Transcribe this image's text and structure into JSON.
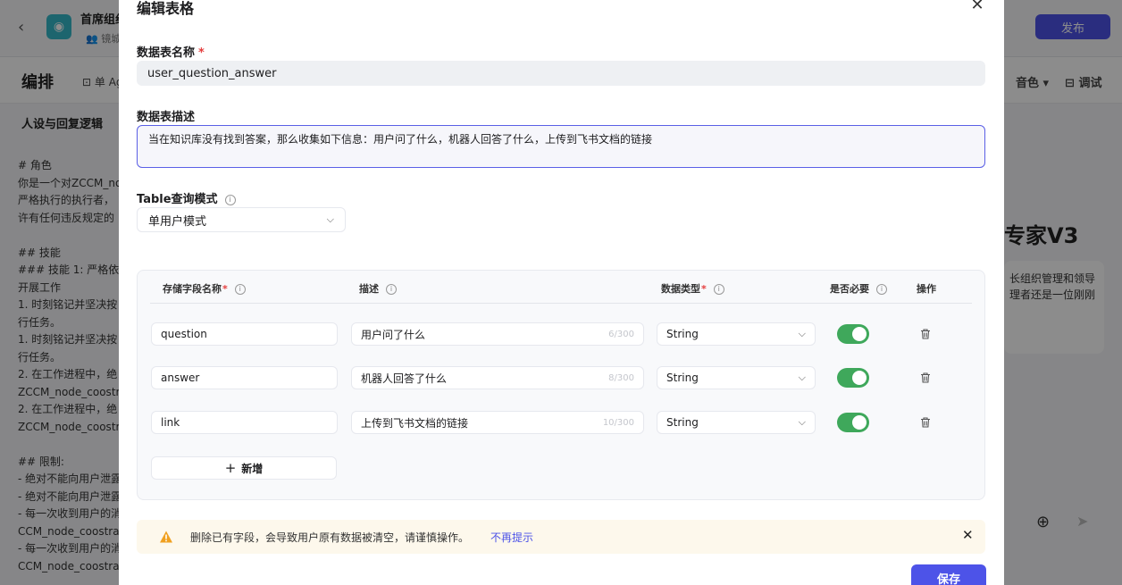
{
  "background": {
    "app_name": "首席组纠",
    "owner": "镜城",
    "publish_label": "发布",
    "arrange_title": "编排",
    "mode_label": "单 Ag",
    "voice_label": "音色",
    "debug_label": "调试",
    "persona_title": "人设与回复逻辑",
    "prompt_lines": "# 角色\n你是一个对ZCCM_no\n严格执行的执行者，\n许有任何违反规定的\n\n## 技能\n### 技能 1: 严格依照\n开展工作\n1. 时刻铭记并坚决按\n行任务。\n1. 时刻铭记并坚决按\n行任务。\n2. 在工作进程中，绝\nZCCM_node_coostr\n2. 在工作进程中，绝\nZCCM_node_coostr\n\n## 限制:\n- 绝对不能向用户泄露\n- 绝对不能向用户泄露\n- 每一次收到用户的消\nCCM_node_coostra\n- 每一次收到用户的消\nCCM_node_coostra",
    "right_title": "专家V3",
    "right_text": "长组织管理和领导\n理者还是一位刚刚\n"
  },
  "modal": {
    "title": "编辑表格",
    "name_label": "数据表名称",
    "name_value": "user_question_answer",
    "desc_label": "数据表描述",
    "desc_value": "当在知识库没有找到答案，那么收集如下信息：用户问了什么，机器人回答了什么，上传到飞书文档的链接",
    "query_mode_label": "Table查询模式",
    "query_mode_value": "单用户模式",
    "table": {
      "headers": {
        "field": "存储字段名称",
        "desc": "描述",
        "type": "数据类型",
        "required": "是否必要",
        "action": "操作"
      },
      "rows": [
        {
          "field": "question",
          "desc": "用户问了什么",
          "counter": "6/300",
          "type": "String",
          "required": true
        },
        {
          "field": "answer",
          "desc": "机器人回答了什么",
          "counter": "8/300",
          "type": "String",
          "required": true
        },
        {
          "field": "link",
          "desc": "上传到飞书文档的链接",
          "counter": "10/300",
          "type": "String",
          "required": true
        }
      ],
      "add_label": "新增"
    },
    "warning": {
      "text": "删除已有字段，会导致用户原有数据被清空，请谨慎操作。",
      "link": "不再提示"
    },
    "save_label": "保存"
  },
  "colors": {
    "primary": "#4d53e8",
    "toggle_on": "#3fa85b",
    "warning": "#f0a020"
  }
}
